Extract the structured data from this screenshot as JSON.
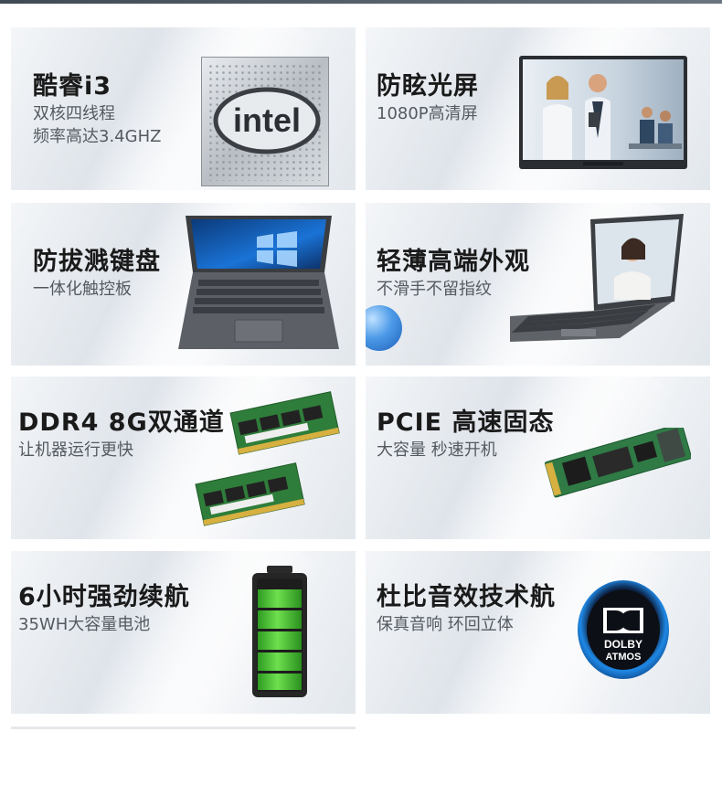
{
  "cards": [
    {
      "title": "酷睿i3",
      "sub1": "双核四线程",
      "sub2": "频率高达3.4GHZ",
      "image": "intel-chip",
      "logo_text": "intel"
    },
    {
      "title": "防眩光屏",
      "sub1": "1080P高清屏",
      "image": "monitor-office-scene"
    },
    {
      "title": "防拔溅键盘",
      "sub1": "一体化触控板",
      "image": "laptop-keyboard-top"
    },
    {
      "title": "轻薄高端外观",
      "sub1": "不滑手不留指纹",
      "image": "laptop-open-woman"
    },
    {
      "title": "DDR4 8G双通道",
      "sub1": "让机器运行更快",
      "image": "ram-modules"
    },
    {
      "title": "PCIE 高速固态",
      "sub1": "大容量 秒速开机",
      "image": "ssd-m2"
    },
    {
      "title": "6小时强劲续航",
      "sub1": "35WH大容量电池",
      "image": "battery-green"
    },
    {
      "title": "杜比音效技术航",
      "sub1": "保真音响 环回立体",
      "image": "dolby-atmos-logo",
      "logo_text1": "DOLBY",
      "logo_text2": "ATMOS"
    }
  ],
  "colors": {
    "title": "#1a1a1a",
    "subtitle": "#555a60",
    "battery_green": "#3fbf2a",
    "dolby_blue": "#1e88e5"
  }
}
